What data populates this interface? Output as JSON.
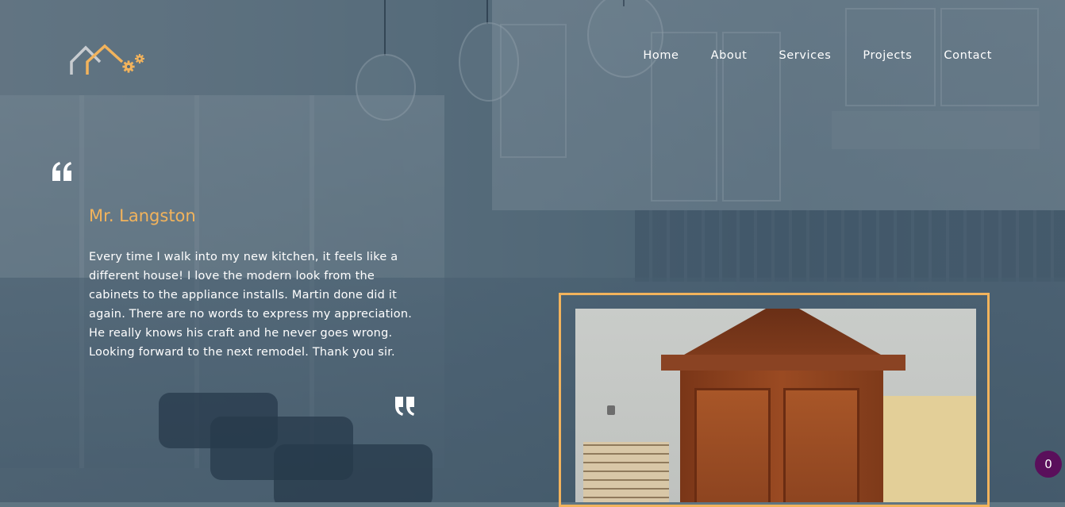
{
  "nav": {
    "items": [
      {
        "label": "Home"
      },
      {
        "label": "About"
      },
      {
        "label": "Services"
      },
      {
        "label": "Projects"
      },
      {
        "label": "Contact"
      }
    ]
  },
  "logo": {
    "icon": "house-gears-logo"
  },
  "testimonial": {
    "name": "Mr. Langston",
    "body": "Every time I walk into my new kitchen, it feels like a different house! I love the modern look from the cabinets to the appliance installs. Martin done did it again. There are no words to express my appreciation. He really knows his craft and he never goes wrong. Looking forward to the next remodel. Thank you sir."
  },
  "cart": {
    "count": "0"
  },
  "colors": {
    "accent": "#f2b35c",
    "overlay": "#30465c",
    "badge": "#5a0f5b",
    "text": "#ffffff"
  }
}
